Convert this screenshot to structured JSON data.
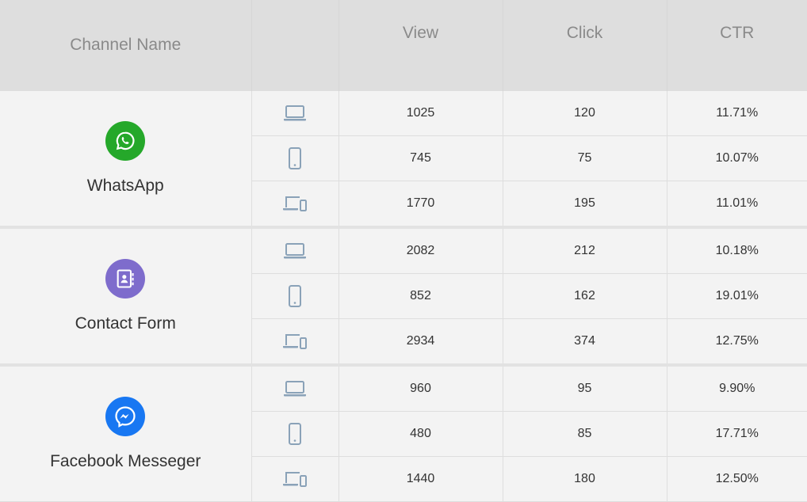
{
  "header": {
    "channel_name": "Channel Name",
    "device": "",
    "view": "View",
    "click": "Click",
    "ctr": "CTR"
  },
  "colors": {
    "whatsapp": "#25a82a",
    "contact_form": "#7e6ccc",
    "messenger": "#1877f2",
    "device_icon": "#8aa2b8"
  },
  "channels": [
    {
      "name": "WhatsApp",
      "icon": "whatsapp-icon",
      "rows": [
        {
          "device": "laptop-icon",
          "view": "1025",
          "click": "120",
          "ctr": "11.71%"
        },
        {
          "device": "mobile-icon",
          "view": "745",
          "click": "75",
          "ctr": "10.07%"
        },
        {
          "device": "multi-device-icon",
          "view": "1770",
          "click": "195",
          "ctr": "11.01%"
        }
      ]
    },
    {
      "name": "Contact Form",
      "icon": "contact-form-icon",
      "rows": [
        {
          "device": "laptop-icon",
          "view": "2082",
          "click": "212",
          "ctr": "10.18%"
        },
        {
          "device": "mobile-icon",
          "view": "852",
          "click": "162",
          "ctr": "19.01%"
        },
        {
          "device": "multi-device-icon",
          "view": "2934",
          "click": "374",
          "ctr": "12.75%"
        }
      ]
    },
    {
      "name": "Facebook Messeger",
      "icon": "messenger-icon",
      "rows": [
        {
          "device": "laptop-icon",
          "view": "960",
          "click": "95",
          "ctr": "9.90%"
        },
        {
          "device": "mobile-icon",
          "view": "480",
          "click": "85",
          "ctr": "17.71%"
        },
        {
          "device": "multi-device-icon",
          "view": "1440",
          "click": "180",
          "ctr": "12.50%"
        }
      ]
    }
  ]
}
